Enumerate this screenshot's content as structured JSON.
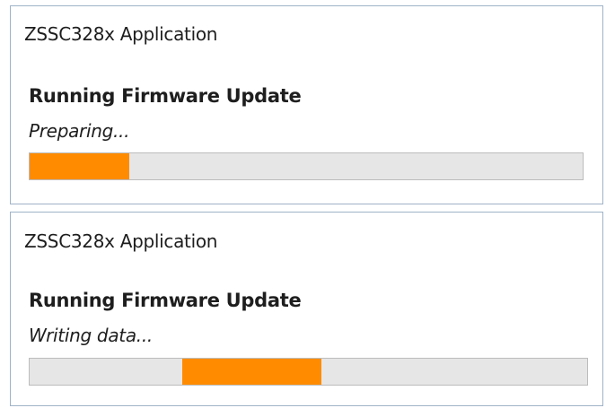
{
  "dialogs": [
    {
      "title": "ZSSC328x Application",
      "heading": "Running Firmware Update",
      "status": "Preparing...",
      "progress": {
        "start_fraction": 0.0,
        "fill_fraction": 0.18,
        "color": "#ff8c00"
      }
    },
    {
      "title": "ZSSC328x Application",
      "heading": "Running Firmware Update",
      "status": "Writing data...",
      "progress": {
        "start_fraction": 0.273,
        "fill_fraction": 0.25,
        "color": "#ff8c00"
      }
    }
  ]
}
